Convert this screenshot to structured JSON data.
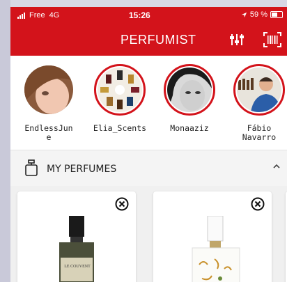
{
  "status": {
    "carrier": "Free",
    "network": "4G",
    "time": "15:26",
    "battery": "59 %"
  },
  "header": {
    "title": "PERFUMIST",
    "filter_icon": "sliders-icon",
    "scan_icon": "barcode-scan-icon"
  },
  "stories": [
    {
      "name": "EndlessJun\ne",
      "active": false
    },
    {
      "name": "Elia_Scents",
      "active": true
    },
    {
      "name": "Monaaziz",
      "active": true
    },
    {
      "name": "Fábio\nNavarro",
      "active": true
    }
  ],
  "section": {
    "label": "MY PERFUMES",
    "icon": "perfume-bottle-icon",
    "toggle_icon": "chevron-up-icon"
  },
  "perfumes": [
    {
      "brand_text": "LE COUVENT"
    },
    {
      "brand_text": ""
    }
  ],
  "colors": {
    "accent": "#d3131b",
    "background": "#f4f4f4"
  }
}
